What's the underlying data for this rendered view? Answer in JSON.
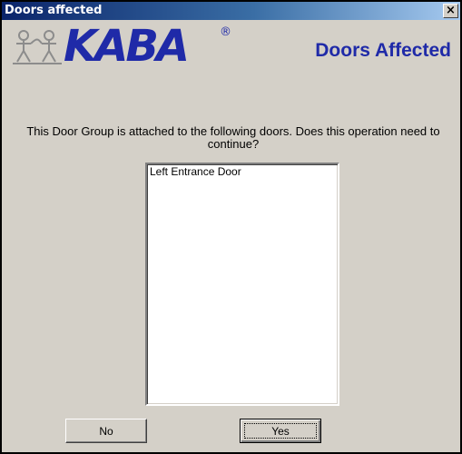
{
  "window": {
    "title": "Doors affected",
    "close_label": "×"
  },
  "header": {
    "logo_text": "KABA",
    "logo_registered": "®",
    "heading": "Doors Affected"
  },
  "message": "This Door Group is attached to the following doors. Does this operation need to continue?",
  "doors_list": {
    "items": [
      "Left Entrance Door"
    ]
  },
  "buttons": {
    "no_label": "No",
    "yes_label": "Yes"
  },
  "colors": {
    "brand_blue": "#1f2aa8",
    "titlebar_start": "#0a246a",
    "titlebar_end": "#a6caf0",
    "dialog_face": "#d4d0c8"
  },
  "icons": {
    "close": "close-icon",
    "logo_emblem": "kaba-emblem-icon"
  }
}
